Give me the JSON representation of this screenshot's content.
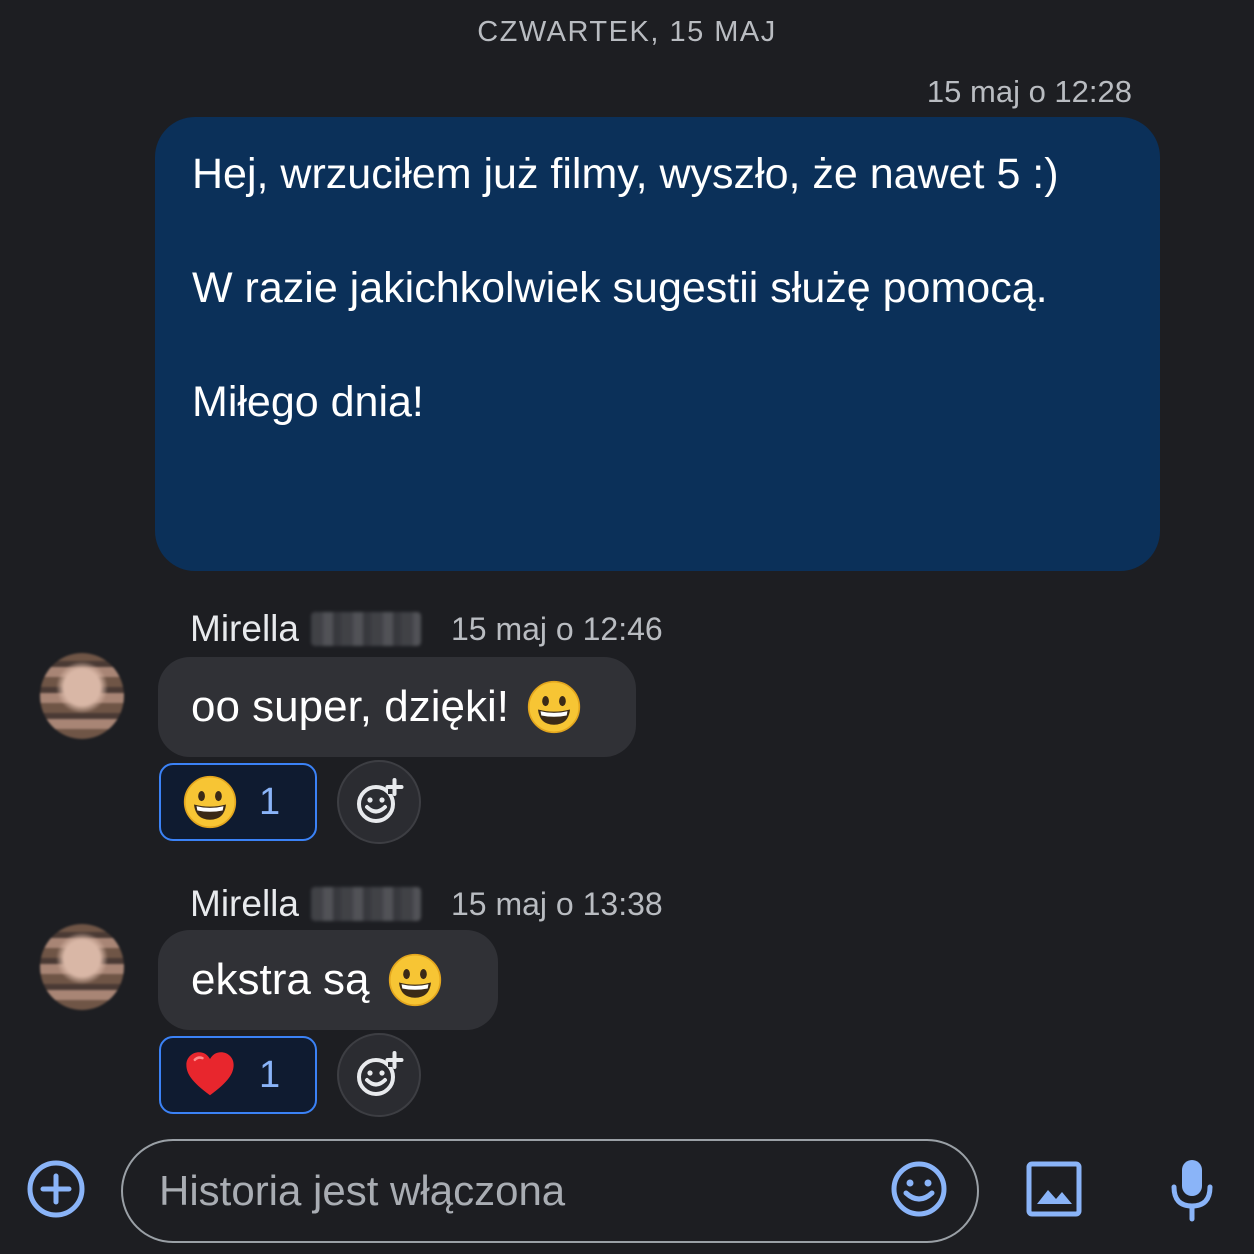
{
  "conversation": {
    "date_divider": "CZWARTEK, 15 MAJ"
  },
  "messages": [
    {
      "direction": "outgoing",
      "timestamp": "15 maj o 12:28",
      "paragraphs": [
        "Hej, wrzuciłem już filmy, wyszło, że nawet 5 :)",
        "W razie jakichkolwiek sugestii służę pomocą.",
        "Miłego dnia!"
      ]
    },
    {
      "direction": "incoming",
      "sender_name": "Mirella",
      "timestamp": "15 maj o 12:46",
      "text": "oo super, dzięki!",
      "inline_emoji": "grinning-face",
      "reaction": {
        "emoji": "grinning-face",
        "count": "1"
      }
    },
    {
      "direction": "incoming",
      "sender_name": "Mirella",
      "timestamp": "15 maj o 13:38",
      "text": "ekstra są",
      "inline_emoji": "grinning-face",
      "reaction": {
        "emoji": "red-heart",
        "count": "1"
      }
    }
  ],
  "composer": {
    "placeholder": "Historia jest włączona",
    "icons": [
      "add-circle-icon",
      "emoji-icon",
      "image-icon",
      "microphone-icon"
    ]
  },
  "colors": {
    "background": "#1d1e22",
    "own_bubble": "#0b3059",
    "incoming_bubble": "#303136",
    "accent": "#8ab4f8",
    "reaction_border": "#3b82f6"
  }
}
